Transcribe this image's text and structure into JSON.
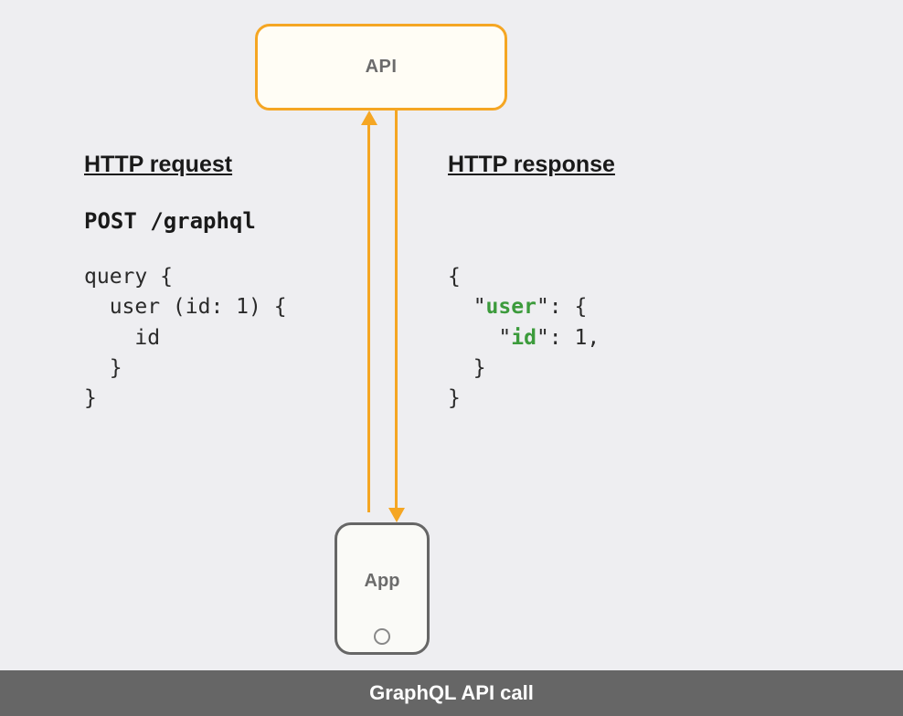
{
  "api": {
    "label": "API"
  },
  "app": {
    "label": "App"
  },
  "request": {
    "heading": "HTTP request",
    "endpoint": "POST /graphql",
    "code": {
      "l1": "query {",
      "l2": "  user (id: 1) {",
      "l3": "    id",
      "l4": "  }",
      "l5": "}"
    }
  },
  "response": {
    "heading": "HTTP response",
    "code": {
      "l1": "{",
      "l2a": "  \"",
      "l2k": "user",
      "l2b": "\": {",
      "l3a": "    \"",
      "l3k": "id",
      "l3b": "\": 1,",
      "l4": "  }",
      "l5": "}"
    }
  },
  "footer": {
    "title": "GraphQL API call"
  },
  "colors": {
    "accent": "#f5a623",
    "keyword": "#3c9b3c",
    "footer": "#666666"
  }
}
